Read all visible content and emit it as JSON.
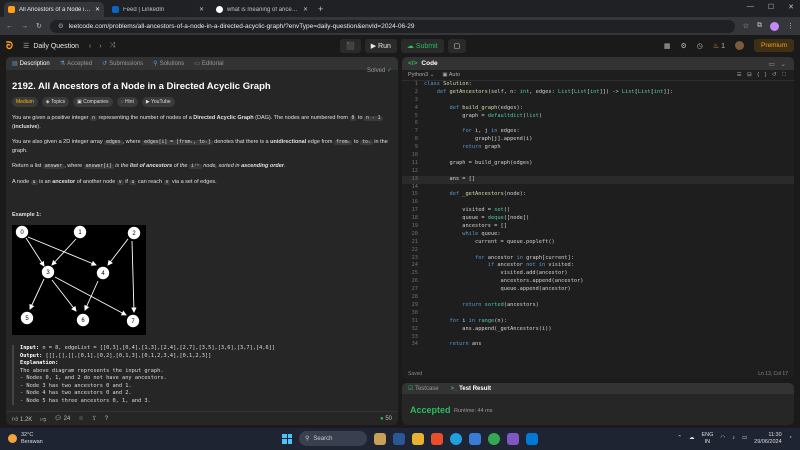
{
  "browser": {
    "tabs": [
      {
        "title": "All Ancestors of a Node in a D",
        "favicon_color": "#ffa116",
        "active": true
      },
      {
        "title": "Feed | LinkedIn",
        "favicon_color": "#0a66c2",
        "active": false
      },
      {
        "title": "what is meaning of ancestors",
        "favicon_color": "#ffffff",
        "active": false
      }
    ],
    "new_tab_label": "+",
    "url": "leetcode.com/problems/all-ancestors-of-a-node-in-a-directed-acyclic-graph/?envType=daily-question&envId=2024-06-29"
  },
  "nav": {
    "daily_question": "Daily Question",
    "run_label": "Run",
    "submit_label": "Submit",
    "streak_count": "1",
    "premium_label": "Premium"
  },
  "problem_tabs": [
    "Description",
    "Accepted",
    "Submissions",
    "Solutions",
    "Editorial"
  ],
  "problem": {
    "title": "2192. All Ancestors of a Node in a Directed Acyclic Graph",
    "solved_label": "Solved",
    "tags": [
      "Medium",
      "Topics",
      "Companies",
      "Hint",
      "YouTube"
    ],
    "p1_a": "You are given a positive integer ",
    "p1_code1": "n",
    "p1_b": " representing the number of nodes of a ",
    "p1_bold": "Directed Acyclic Graph",
    "p1_c": " (DAG). The nodes are numbered from ",
    "p1_code2": "0",
    "p1_d": " to ",
    "p1_code3": "n - 1",
    "p1_e": " (",
    "p1_bold2": "inclusive",
    "p1_f": ").",
    "p2_a": "You are also given a 2D integer array ",
    "p2_code1": "edges",
    "p2_b": ", where ",
    "p2_code2": "edges[i] = [fromᵢ, toᵢ]",
    "p2_c": " denotes that there is a ",
    "p2_bold": "unidirectional",
    "p2_d": " edge from ",
    "p2_code3": "fromᵢ",
    "p2_e": " to ",
    "p2_code4": "toᵢ",
    "p2_f": " in the graph.",
    "p3_a": "Return a list ",
    "p3_code1": "answer",
    "p3_b": ", where ",
    "p3_code2": "answer[i]",
    "p3_c": " is the ",
    "p3_bold": "list of ancestors",
    "p3_d": " of the ",
    "p3_sup": "iᵗʰ",
    "p3_e": " node, sorted in ",
    "p3_bold2": "ascending order",
    "p3_f": ".",
    "p4_a": "A node ",
    "p4_code1": "u",
    "p4_b": " is an ",
    "p4_bold": "ancestor",
    "p4_c": " of another node ",
    "p4_code2": "v",
    "p4_d": " if ",
    "p4_code3": "u",
    "p4_e": " can reach ",
    "p4_code4": "v",
    "p4_f": " via a set of edges.",
    "example_title": "Example 1:",
    "graph_nodes": [
      "0",
      "1",
      "2",
      "3",
      "4",
      "5",
      "6",
      "7"
    ],
    "input_label": "Input:",
    "input_value": " n = 8, edgeList = [[0,3],[0,4],[1,3],[2,4],[2,7],[3,5],[3,6],[3,7],[4,6]]",
    "output_label": "Output:",
    "output_value": " [[],[],[],[0,1],[0,2],[0,1,3],[0,1,2,3,4],[0,1,2,3]]",
    "explanation_label": "Explanation:",
    "explanation_lines": [
      "The above diagram represents the input graph.",
      "- Nodes 0, 1, and 2 do not have any ancestors.",
      "- Node 3 has two ancestors 0 and 1.",
      "- Node 4 has two ancestors 0 and 2.",
      "- Node 5 has three ancestors 0, 1, and 3."
    ]
  },
  "footer": {
    "likes": "1.2K",
    "comments": "24",
    "online": "50"
  },
  "code_panel": {
    "title": "Code",
    "language": "Python3",
    "auto_label": "Auto",
    "status_left": "Saved",
    "status_right": "Ln 13, Col 17",
    "lines": [
      {
        "n": "1",
        "t": "class Solution:"
      },
      {
        "n": "2",
        "t": "    def getAncestors(self, n: int, edges: List[List[int]]) -> List[List[int]]:"
      },
      {
        "n": "3",
        "t": ""
      },
      {
        "n": "4",
        "t": "        def build_graph(edges):"
      },
      {
        "n": "5",
        "t": "            graph = defaultdict(list)"
      },
      {
        "n": "6",
        "t": ""
      },
      {
        "n": "7",
        "t": "            for i, j in edges:"
      },
      {
        "n": "8",
        "t": "                graph[j].append(i)"
      },
      {
        "n": "9",
        "t": "            return graph"
      },
      {
        "n": "10",
        "t": ""
      },
      {
        "n": "11",
        "t": "        graph = build_graph(edges)"
      },
      {
        "n": "12",
        "t": ""
      },
      {
        "n": "13",
        "t": "        ans = []"
      },
      {
        "n": "14",
        "t": ""
      },
      {
        "n": "15",
        "t": "        def _getAncestors(node):"
      },
      {
        "n": "16",
        "t": ""
      },
      {
        "n": "17",
        "t": "            visited = set()"
      },
      {
        "n": "18",
        "t": "            queue = deque([node])"
      },
      {
        "n": "19",
        "t": "            ancestors = []"
      },
      {
        "n": "20",
        "t": "            while queue:"
      },
      {
        "n": "21",
        "t": "                current = queue.popleft()"
      },
      {
        "n": "22",
        "t": ""
      },
      {
        "n": "23",
        "t": "                for ancestor in graph[current]:"
      },
      {
        "n": "24",
        "t": "                    if ancestor not in visited:"
      },
      {
        "n": "25",
        "t": "                        visited.add(ancestor)"
      },
      {
        "n": "26",
        "t": "                        ancestors.append(ancestor)"
      },
      {
        "n": "27",
        "t": "                        queue.append(ancestor)"
      },
      {
        "n": "28",
        "t": ""
      },
      {
        "n": "29",
        "t": "            return sorted(ancestors)"
      },
      {
        "n": "30",
        "t": ""
      },
      {
        "n": "31",
        "t": "        for i in range(n):"
      },
      {
        "n": "32",
        "t": "            ans.append(_getAncestors(i))"
      },
      {
        "n": "33",
        "t": ""
      },
      {
        "n": "34",
        "t": "        return ans"
      }
    ]
  },
  "result_panel": {
    "testcase_label": "Testcase",
    "result_label": "Test Result",
    "status": "Accepted",
    "runtime": "Runtime: 44 ms"
  },
  "taskbar": {
    "temp": "32°C",
    "weather": "Berawan",
    "search_placeholder": "Search",
    "lang_top": "ENG",
    "lang_bottom": "IN",
    "time": "11:30",
    "date": "29/06/2024"
  },
  "colors": {
    "accent": "#ffa116",
    "success": "#2cbb5d",
    "keyword": "#569cd6"
  }
}
